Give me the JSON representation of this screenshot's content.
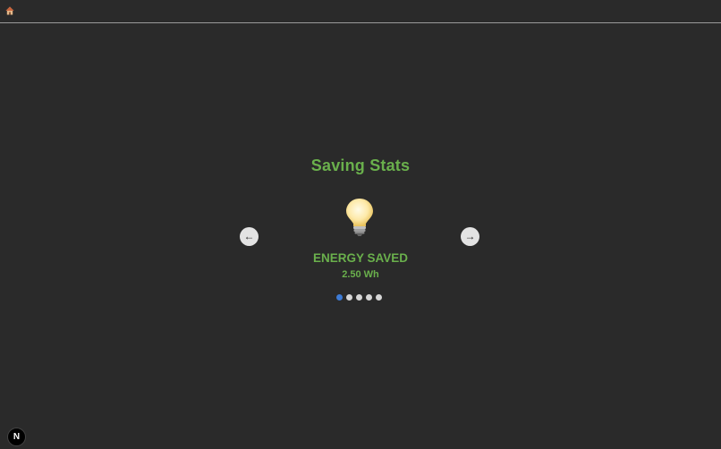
{
  "header": {
    "home_icon": "home-icon"
  },
  "carousel": {
    "title": "Saving Stats",
    "slide": {
      "icon": "lightbulb-icon",
      "label": "ENERGY SAVED",
      "value": "2.50 Wh"
    },
    "prev_label": "←",
    "next_label": "→",
    "dot_count": 5,
    "active_index": 0
  },
  "footer": {
    "badge_label": "N"
  },
  "colors": {
    "background": "#2a2a2a",
    "accent_green": "#6ab04c",
    "active_dot": "#3d7bd6",
    "inactive_dot": "#d6d6d6"
  }
}
